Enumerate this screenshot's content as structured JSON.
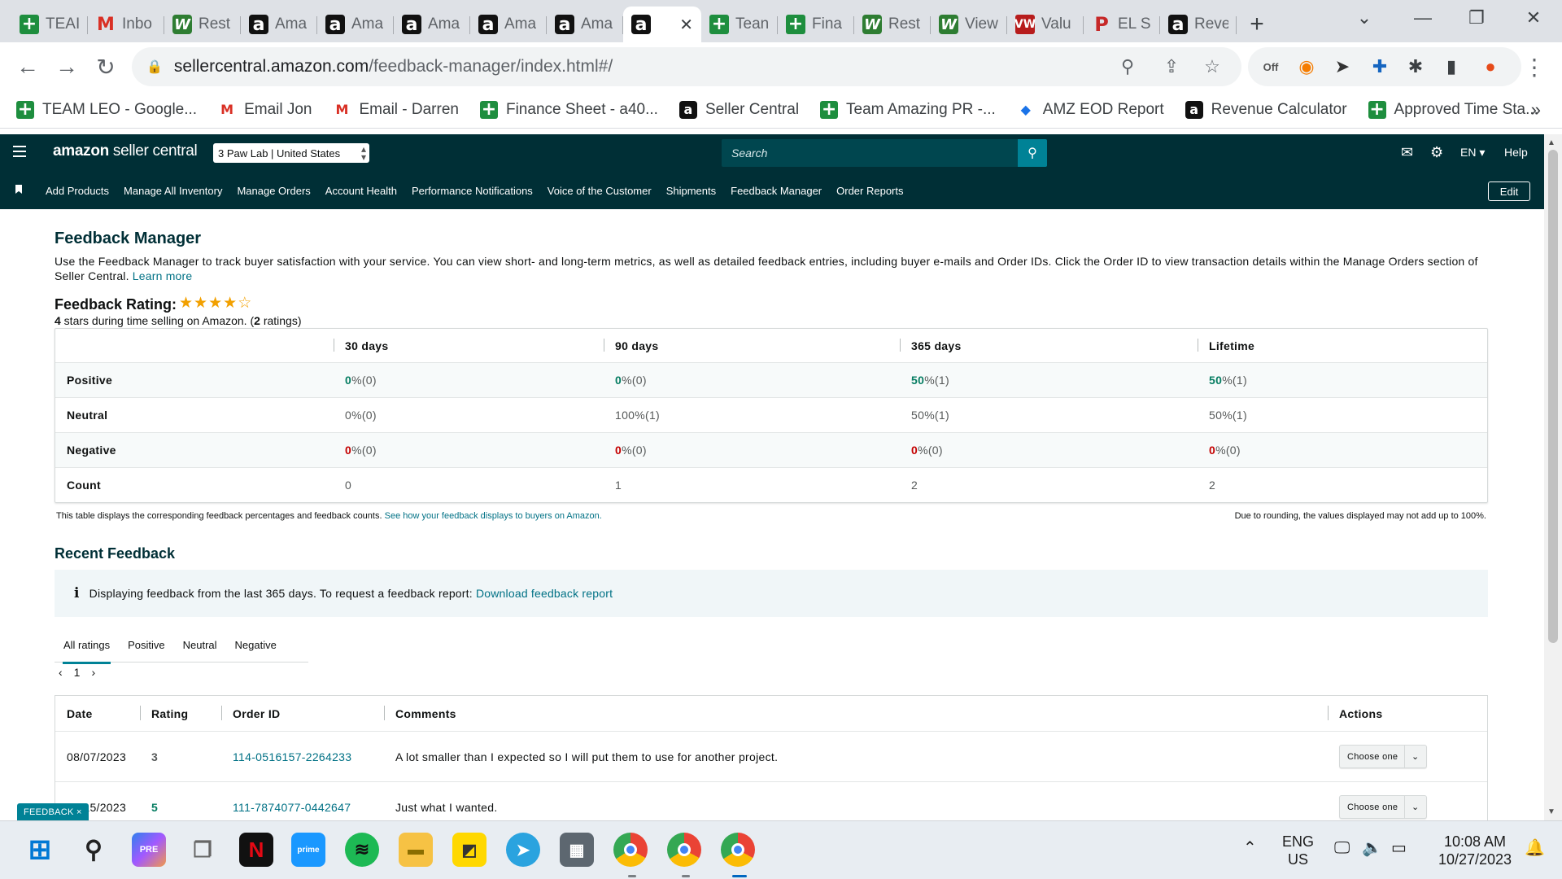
{
  "browser": {
    "tabs": [
      {
        "label": "TEAI",
        "icon": "sheets"
      },
      {
        "label": "Inbo",
        "icon": "gmail"
      },
      {
        "label": "Rest",
        "icon": "w"
      },
      {
        "label": "Ama",
        "icon": "amazon"
      },
      {
        "label": "Ama",
        "icon": "amazon"
      },
      {
        "label": "Ama",
        "icon": "amazon"
      },
      {
        "label": "Ama",
        "icon": "amazon"
      },
      {
        "label": "Ama",
        "icon": "amazon"
      },
      {
        "label": "",
        "icon": "amazon",
        "active": true
      },
      {
        "label": "Tean",
        "icon": "sheets"
      },
      {
        "label": "Fina",
        "icon": "sheets"
      },
      {
        "label": "Rest",
        "icon": "w"
      },
      {
        "label": "View",
        "icon": "w"
      },
      {
        "label": "Valu",
        "icon": "vw"
      },
      {
        "label": "EL S",
        "icon": "pin"
      },
      {
        "label": "Reve",
        "icon": "amazon"
      }
    ],
    "url_host": "sellercentral.amazon.com",
    "url_path": "/feedback-manager/index.html#/",
    "bookmarks": [
      {
        "label": "TEAM LEO - Google...",
        "icon": "sheets"
      },
      {
        "label": "Email Jon",
        "icon": "gmail"
      },
      {
        "label": "Email - Darren",
        "icon": "gmail"
      },
      {
        "label": "Finance Sheet - a40...",
        "icon": "sheets"
      },
      {
        "label": "Seller Central",
        "icon": "amazon"
      },
      {
        "label": "Team Amazing PR -...",
        "icon": "sheets"
      },
      {
        "label": "AMZ EOD Report",
        "icon": "diamond"
      },
      {
        "label": "Revenue Calculator",
        "icon": "amazon"
      },
      {
        "label": "Approved Time Sta...",
        "icon": "sheets"
      }
    ]
  },
  "header": {
    "logo_amazon": "amazon",
    "logo_rest": " seller central",
    "account": "3 Paw Lab | United States",
    "search_placeholder": "Search",
    "language": "EN",
    "help": "Help",
    "nav": [
      "Add Products",
      "Manage All Inventory",
      "Manage Orders",
      "Account Health",
      "Performance Notifications",
      "Voice of the Customer",
      "Shipments",
      "Feedback Manager",
      "Order Reports"
    ],
    "edit": "Edit"
  },
  "page": {
    "title": "Feedback Manager",
    "intro": "Use the Feedback Manager to track buyer satisfaction with your service. You can view short- and long-term metrics, as well as detailed feedback entries, including buyer e-mails and Order IDs. Click the Order ID to view transaction details within the Manage Orders section of Seller Central.",
    "learn_more": "Learn more",
    "rating_label": "Feedback Rating:",
    "rating_stars": 4,
    "rating_sub_stars": "4",
    "rating_sub_a": " stars during time selling on Amazon. (",
    "rating_sub_count": "2",
    "rating_sub_b": " ratings)",
    "metrics": {
      "columns": [
        "30 days",
        "90 days",
        "365 days",
        "Lifetime"
      ],
      "rows": [
        {
          "label": "Positive",
          "cells": [
            {
              "pct": "0",
              "rest": " %(0)"
            },
            {
              "pct": "0",
              "rest": " %(0)"
            },
            {
              "pct": "50",
              "rest": " %(1)"
            },
            {
              "pct": "50",
              "rest": " %(1)"
            }
          ]
        },
        {
          "label": "Neutral",
          "cells": [
            {
              "pct": "0",
              "rest": " %(0)"
            },
            {
              "pct": "100",
              "rest": " %(1)"
            },
            {
              "pct": "50",
              "rest": " %(1)"
            },
            {
              "pct": "50",
              "rest": " %(1)"
            }
          ]
        },
        {
          "label": "Negative",
          "cells": [
            {
              "pct": "0",
              "rest": " %(0)"
            },
            {
              "pct": "0",
              "rest": " %(0)"
            },
            {
              "pct": "0",
              "rest": " %(0)"
            },
            {
              "pct": "0",
              "rest": " %(0)"
            }
          ]
        },
        {
          "label": "Count",
          "cells": [
            {
              "pct": "",
              "rest": "0"
            },
            {
              "pct": "",
              "rest": "1"
            },
            {
              "pct": "",
              "rest": "2"
            },
            {
              "pct": "",
              "rest": "2"
            }
          ]
        }
      ]
    },
    "table_note": "This table displays the corresponding feedback percentages and feedback counts.",
    "table_note_link": "See how your feedback displays to buyers on Amazon.",
    "table_note_right": "Due to rounding, the values displayed may not add up to 100%.",
    "recent_title": "Recent Feedback",
    "info_text": "Displaying feedback from the last 365 days. To request a feedback report: ",
    "info_link": "Download feedback report",
    "filter_tabs": [
      "All ratings",
      "Positive",
      "Neutral",
      "Negative"
    ],
    "pager_current": "1",
    "feedback_columns": [
      "Date",
      "Rating",
      "Order ID",
      "Comments",
      "Actions"
    ],
    "feedback_rows": [
      {
        "date": "08/07/2023",
        "rating": "3",
        "order_id": "114-0516157-2264233",
        "comment": "A lot smaller than I expected so I will put them to use for another project.",
        "action": "Choose one"
      },
      {
        "date": "07/15/2023",
        "rating": "5",
        "order_id": "111-7874077-0442647",
        "comment": "Just what I wanted.",
        "action": "Choose one"
      }
    ],
    "feedback_tab": "FEEDBACK ×"
  },
  "taskbar": {
    "lang_line1": "ENG",
    "lang_line2": "US",
    "time": "10:08 AM",
    "date": "10/27/2023"
  },
  "colors": {
    "header_bg": "#002f36",
    "positive": "#067d62",
    "negative": "#c40000",
    "link": "#007185",
    "star": "#f2a000"
  }
}
